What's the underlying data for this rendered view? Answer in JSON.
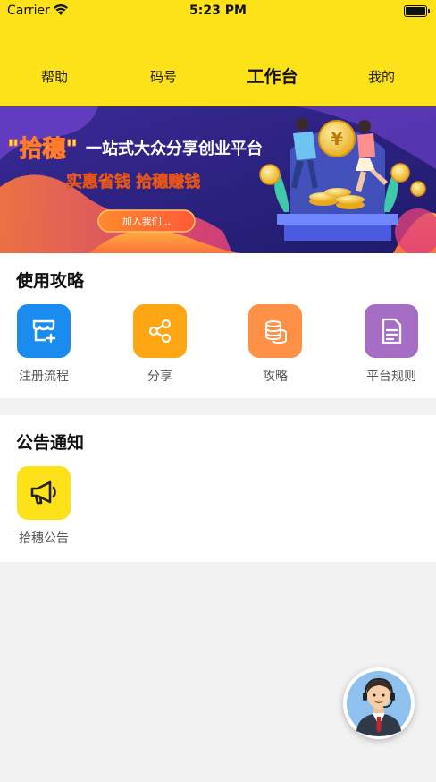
{
  "status_bar": {
    "carrier": "Carrier",
    "time": "5:23 PM"
  },
  "tabs": [
    {
      "label": "帮助"
    },
    {
      "label": "码号"
    },
    {
      "label": "工作台"
    },
    {
      "label": "我的"
    }
  ],
  "banner": {
    "headline_quote": "\"拾穗\"",
    "headline_rest": "一站式大众分享创业平台",
    "slogan": "实惠省钱  拾穗赚钱",
    "join_button": "加入我们...",
    "coin_symbol": "¥"
  },
  "guide": {
    "title": "使用攻略",
    "items": [
      {
        "label": "注册流程",
        "icon": "store-add-icon",
        "color": "#1a8cf0"
      },
      {
        "label": "分享",
        "icon": "share-icon",
        "color": "#ffa614"
      },
      {
        "label": "攻略",
        "icon": "coins-stack-icon",
        "color": "#ff9147"
      },
      {
        "label": "平台规则",
        "icon": "document-icon",
        "color": "#a56ec4"
      }
    ]
  },
  "notice": {
    "title": "公告通知",
    "items": [
      {
        "label": "拾穗公告",
        "icon": "megaphone-icon",
        "color": "#fde21a"
      }
    ]
  },
  "customer_service": {
    "icon": "customer-service-agent-icon"
  }
}
